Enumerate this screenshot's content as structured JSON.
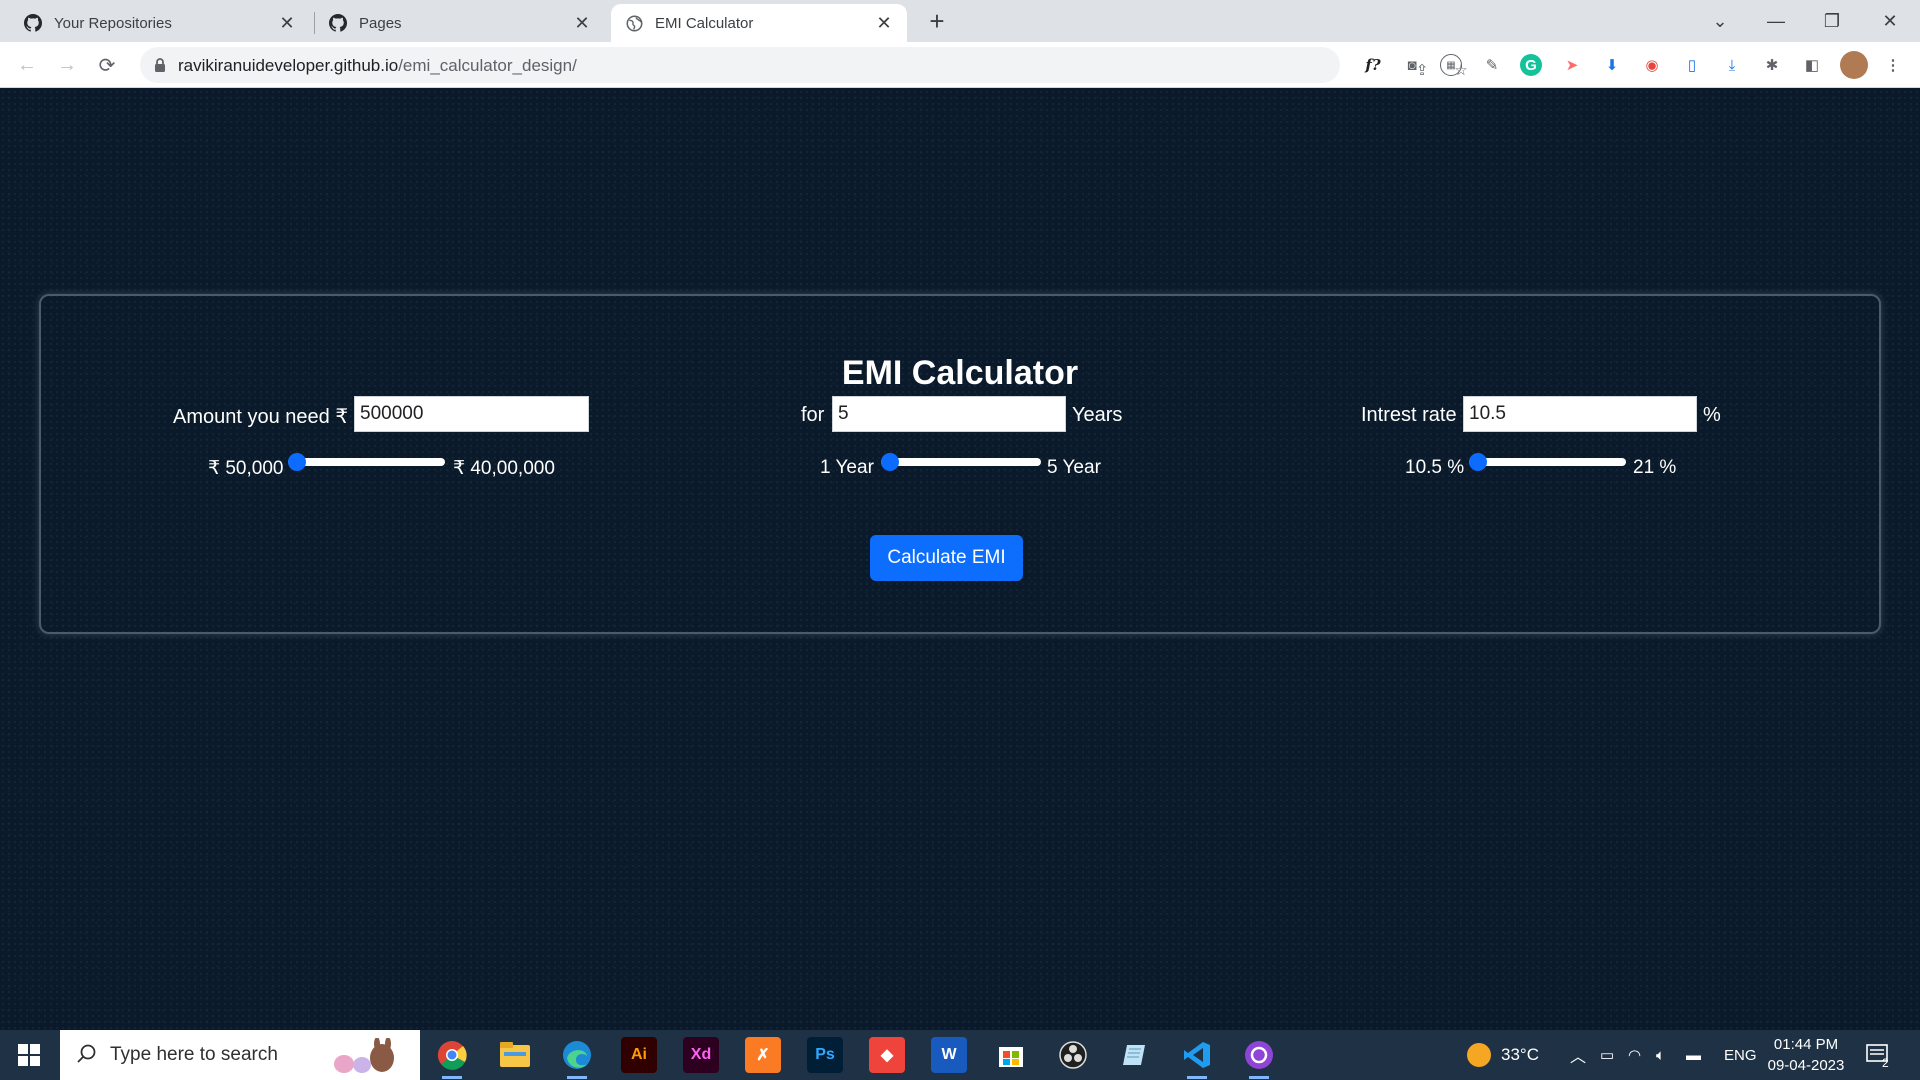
{
  "browser": {
    "tabs": [
      {
        "title": "Your Repositories",
        "icon": "github-icon",
        "active": false
      },
      {
        "title": "Pages",
        "icon": "github-icon",
        "active": false
      },
      {
        "title": "EMI Calculator",
        "icon": "globe-icon",
        "active": true
      }
    ],
    "url_host": "ravikiranuideveloper.github.io",
    "url_path": "/emi_calculator_design/"
  },
  "page": {
    "title": "EMI Calculator",
    "amount": {
      "label": "Amount you need ₹",
      "value": "500000",
      "min_label": "₹ 50,000",
      "max_label": "₹ 40,00,000",
      "slider_fraction": 0.0
    },
    "tenure": {
      "prefix": "for",
      "value": "5",
      "suffix": "Years",
      "min_label": "1 Year",
      "max_label": "5 Year",
      "slider_fraction": 0.0
    },
    "interest": {
      "label": "Intrest rate",
      "value": "10.5",
      "suffix": "%",
      "min_label": "10.5 %",
      "max_label": "21 %",
      "slider_fraction": 0.0
    },
    "button_label": "Calculate EMI",
    "colors": {
      "accent": "#0d6efd",
      "background": "#0b1a2a"
    }
  },
  "taskbar": {
    "search_placeholder": "Type here to search",
    "weather": "33°C",
    "language": "ENG",
    "time": "01:44 PM",
    "date": "09-04-2023",
    "notification_count": "2",
    "apps": [
      "chrome-icon",
      "file-explorer-icon",
      "edge-icon",
      "illustrator-icon",
      "xd-icon",
      "xampp-icon",
      "photoshop-icon",
      "anydesk-icon",
      "word-icon",
      "store-icon",
      "obs-icon",
      "notes-icon",
      "vscode-icon",
      "github-desktop-icon"
    ],
    "app_labels": {
      "illustrator": "Ai",
      "xd": "Xd",
      "photoshop": "Ps",
      "word": "W"
    }
  }
}
